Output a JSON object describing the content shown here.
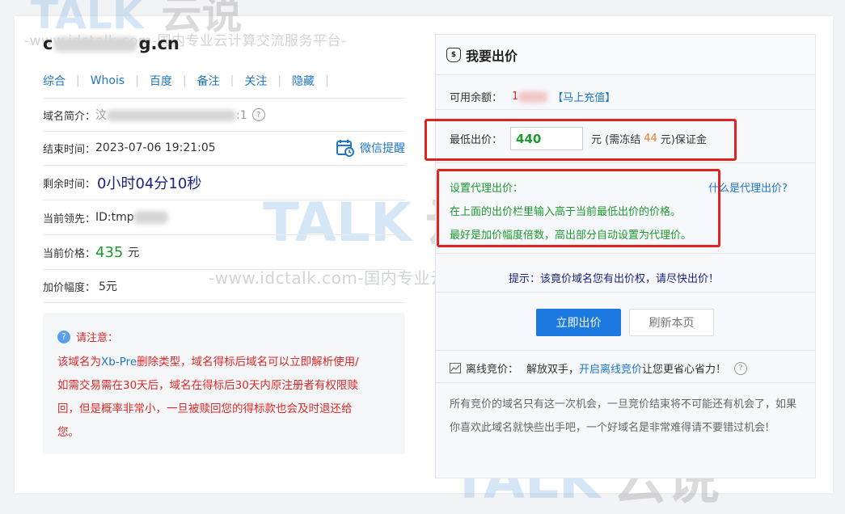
{
  "watermark": {
    "line": "-www.idctalk.com-国内专业云计算交流服务平台-",
    "logo_latin": "TALK",
    "logo_cn": "云说"
  },
  "domain": {
    "suffix": "g.cn",
    "prefix_visible": "c"
  },
  "links": [
    "综合",
    "Whois",
    "百度",
    "备注",
    "关注",
    "隐藏"
  ],
  "info": {
    "intro_label": "域名简介：",
    "intro_prefix": "汶",
    "intro_suffix": ":1",
    "end_label": "结束时间：",
    "end_value": "2023-07-06 19:21:05",
    "wechat_remind": "微信提醒",
    "remain_label": "剩余时间：",
    "remain_value": "0小时04分10秒",
    "leader_label": "当前领先：",
    "leader_value": "ID:tmp",
    "price_label": "当前价格：",
    "price_value": "435",
    "price_unit": "元",
    "increment_label": "加价幅度：",
    "increment_value": "5元"
  },
  "notice": {
    "title": "请注意：",
    "line1_a": "该域名为",
    "line1_b": "Xb-Pre",
    "line1_c": "删除类型，域名得标后域名可以立即解析使用/",
    "line2": "如需交易需在30天后，域名在得标后30天内原注册者有权限赎",
    "line3": "回，但是概率非常小，一旦被赎回您的得标款也会及时退还给",
    "line4": "您。"
  },
  "bid": {
    "title": "我要出价",
    "balance_label": "可用余额：",
    "balance_value": "1",
    "recharge": "【马上充值】",
    "min_label": "最低出价：",
    "min_value": "440",
    "deposit_a": "元 (需冻结",
    "deposit_value": "44",
    "deposit_b": "元)保证金",
    "proxy_title": "设置代理出价：",
    "proxy_help": "什么是代理出价?",
    "proxy_line1": "在上面的出价栏里输入高于当前最低出价的价格。",
    "proxy_line2": "最好是加价幅度倍数，高出部分自动设置为代理价。",
    "tip": "提示：该竟价域名您有出价权，请尽快出价！",
    "submit": "立即出价",
    "refresh": "刷新本页",
    "offline_label": "离线竞价：",
    "offline_text_a": "解放双手，",
    "offline_link": "开启离线竞价",
    "offline_text_b": "让您更省心省力！",
    "footer": "所有竞价的域名只有这一次机会，一旦竞价结束将不可能还有机会了，如果你喜欢此域名就快些出手吧，一个好域名是非常难得请不要错过机会!"
  },
  "colors": {
    "accent": "#1d7ae0",
    "red": "#e32222",
    "green": "#1d9a2f",
    "orange": "#f07a2a"
  }
}
